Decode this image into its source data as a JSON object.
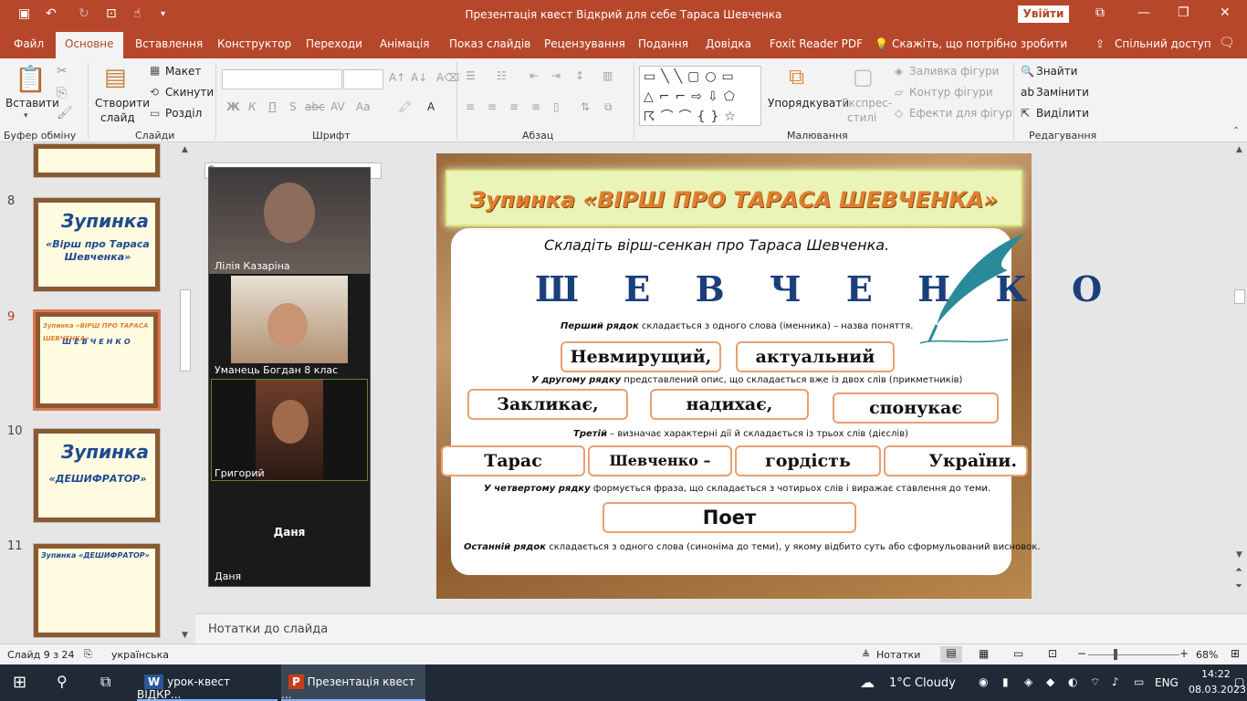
{
  "titlebar": {
    "title": "Презентація квест Відкрий для себе Тараса Шевченка",
    "signin": "Увійти"
  },
  "tabs": [
    "Файл",
    "Основне",
    "Вставлення",
    "Конструктор",
    "Переходи",
    "Анімація",
    "Показ слайдів",
    "Рецензування",
    "Подання",
    "Довідка",
    "Foxit Reader PDF",
    "Скажіть, що потрібно зробити",
    "Спільний доступ"
  ],
  "ribbon": {
    "paste": "Вставити",
    "create_slide": "Створити",
    "slide": "слайд",
    "layout": "Макет",
    "reset": "Скинути",
    "section": "Розділ",
    "arrange": "Упорядкувати",
    "express": "Експрес-",
    "styles": "стилі",
    "fill": "Заливка фігури",
    "outline": "Контур фігури",
    "effects": "Ефекти для фігур",
    "find": "Знайти",
    "replace": "Замінити",
    "select": "Виділити",
    "fmt": [
      "Ж",
      "К",
      "П",
      "S",
      "abc",
      "AV",
      "Aa",
      "A"
    ],
    "groups": [
      "Буфер обміну",
      "Слайди",
      "Шрифт",
      "Абзац",
      "Малювання",
      "Редагування"
    ]
  },
  "thumbs": [
    {
      "num": "8",
      "title": "Зупинка",
      "sub": "«Вірш про Тараса Шевченка»"
    },
    {
      "num": "9",
      "title": "Зупинка «ВІРШ ПРО ТАРАСА ШЕВЧЕНКА»",
      "sub": "ШЕВЧЕНКО"
    },
    {
      "num": "10",
      "title": "Зупинка",
      "sub": "«ДЕШИФРАТОР»"
    },
    {
      "num": "11",
      "title": "Зупинка «ДЕШИФРАТОР»",
      "sub": ""
    }
  ],
  "video": {
    "participants": [
      "Лілія Казаріна",
      "Уманець Богдан 8 клас",
      "Григорий",
      "Даня",
      "Даня"
    ],
    "behind": "Скинути"
  },
  "slide": {
    "title": "Зупинка «ВІРШ ПРО ТАРАСА ШЕВЧЕНКА»",
    "subtitle": "Складіть вірш-сенкан про Тараса Шевченка.",
    "big": "Ш Е В Ч Е Н К О",
    "r1_b": "Перший рядок",
    "r1": " складається з одного слова (іменника) – назва поняття.",
    "w1": "Невмирущий,",
    "w2": "актуальний",
    "r2_b": "У другому рядку",
    "r2": " представлений опис, що складається вже із двох слів (прикметників)",
    "w3": "Закликає,",
    "w4": "надихає,",
    "w5": "спонукає",
    "r3_b": "Третій",
    "r3": " – визначає характерні дії й складається із трьох слів (дієслів)",
    "w6": "Тарас",
    "w7": "Шевченко –",
    "w8": "гордість",
    "w9": "України.",
    "r4_b": "У четвертому рядку",
    "r4": " формується фраза, що складається з чотирьох слів і виражає ставлення до теми.",
    "w10": "Поет",
    "r5_b": "Останній рядок",
    "r5": " складається з одного слова (синоніма до теми), у якому відбито суть або сформульований висновок."
  },
  "notes": "Нотатки до слайда",
  "status": {
    "slide": "Слайд 9 з 24",
    "lang": "українська",
    "notes": "Нотатки",
    "zoom": "68%"
  },
  "taskbar": {
    "app1": "урок-квест ВІДКР...",
    "app2": "Презентація квест ...",
    "weather": "1°C  Cloudy",
    "lang": "ENG",
    "time": "14:22",
    "date": "08.03.2023"
  },
  "colors": {
    "accent": "#b7472a",
    "title_orange": "#e07f2f",
    "big_blue": "#1a3f7a"
  }
}
